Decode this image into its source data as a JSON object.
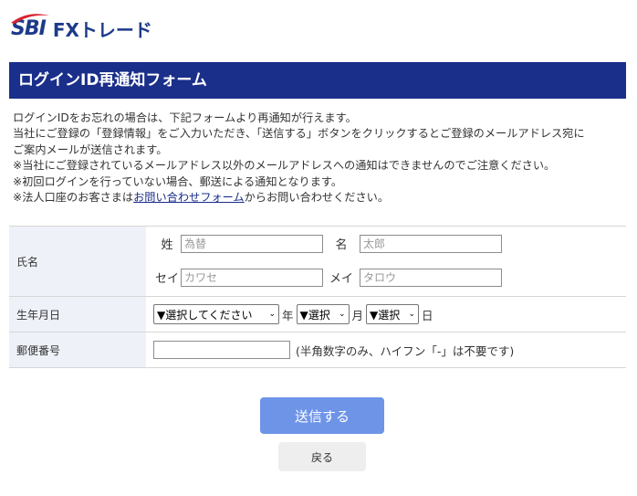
{
  "logo": {
    "brand": "SBI",
    "product": "FXトレード",
    "swoosh_color": "#d9232d",
    "brand_color": "#1d3a8a"
  },
  "banner": {
    "title": "ログインID再通知フォーム",
    "bg_color": "#1a2f8a"
  },
  "intro": {
    "line1": "ログインIDをお忘れの場合は、下記フォームより再通知が行えます。",
    "line2": "当社にご登録の「登録情報」をご入力いただき、「送信する」ボタンをクリックするとご登録のメールアドレス宛に",
    "line3": "ご案内メールが送信されます。",
    "line4": "※当社にご登録されているメールアドレス以外のメールアドレスへの通知はできませんのでご注意ください。",
    "line5": "※初回ログインを行っていない場合、郵送による通知となります。",
    "line6_prefix": "※法人口座のお客さまは",
    "line6_link": "お問い合わせフォーム",
    "line6_suffix": "からお問い合わせください。"
  },
  "form": {
    "name": {
      "label": "氏名",
      "sei_label": "姓",
      "sei_placeholder": "為替",
      "mei_label": "名",
      "mei_placeholder": "太郎",
      "sei_kana_label": "セイ",
      "sei_kana_placeholder": "カワセ",
      "mei_kana_label": "メイ",
      "mei_kana_placeholder": "タロウ"
    },
    "birthday": {
      "label": "生年月日",
      "year_value": "▼選択してください",
      "year_unit": "年",
      "month_value": "▼選択",
      "month_unit": "月",
      "day_value": "▼選択",
      "day_unit": "日"
    },
    "postal": {
      "label": "郵便番号",
      "value": "",
      "note": "(半角数字のみ、ハイフン「-」は不要です)"
    }
  },
  "buttons": {
    "submit": "送信する",
    "back": "戻る",
    "submit_color": "#6e94e8"
  }
}
